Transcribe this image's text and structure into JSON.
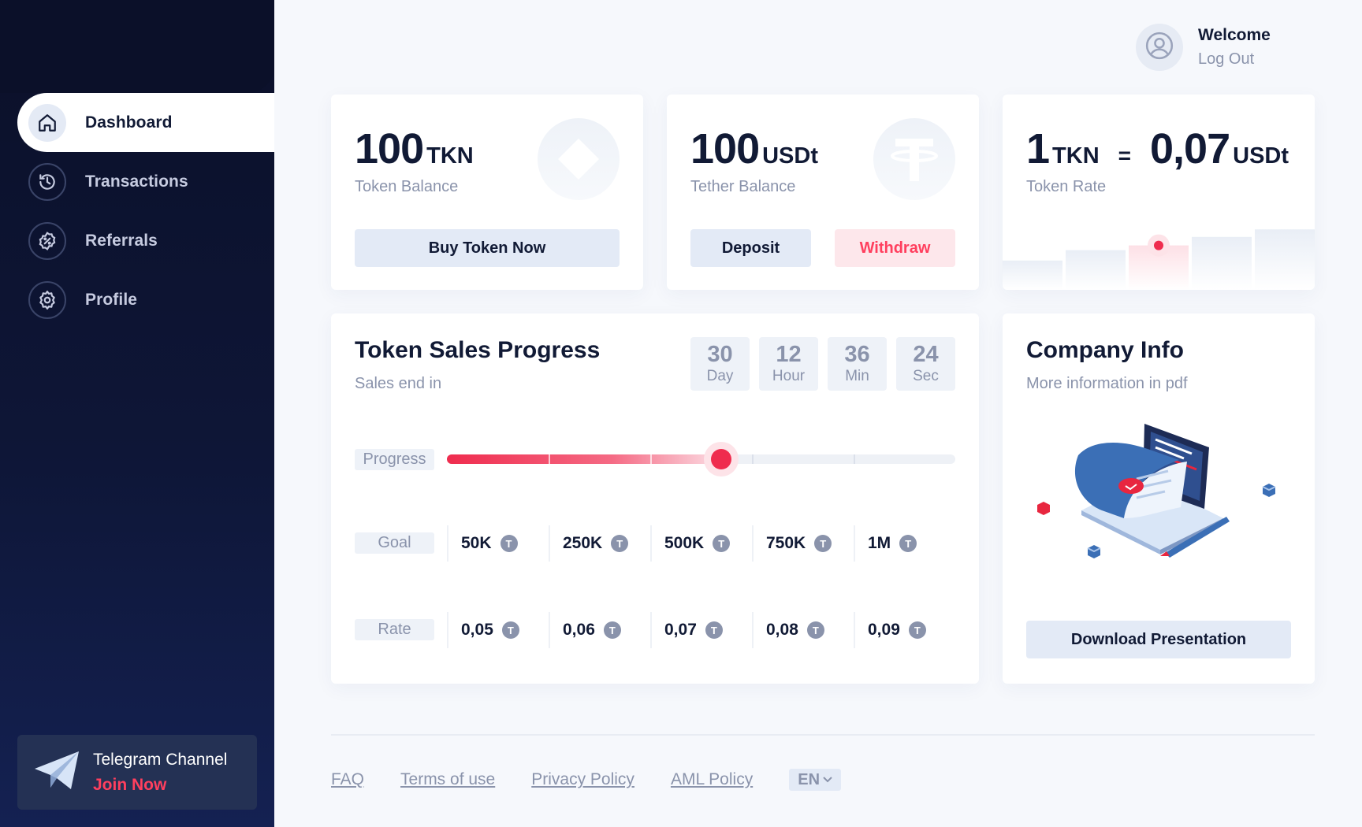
{
  "sidebar": {
    "items": [
      {
        "label": "Dashboard",
        "icon": "home-icon",
        "active": true
      },
      {
        "label": "Transactions",
        "icon": "history-icon"
      },
      {
        "label": "Referrals",
        "icon": "percent-badge-icon"
      },
      {
        "label": "Profile",
        "icon": "gear-icon"
      }
    ],
    "telegram": {
      "title": "Telegram Channel",
      "link": "Join Now",
      "icon": "paper-plane-icon"
    }
  },
  "header": {
    "welcome": "Welcome",
    "logout": "Log Out",
    "avatar_icon": "user-circle-icon"
  },
  "token_card": {
    "amount": "100",
    "unit": "TKN",
    "label": "Token Balance",
    "button": "Buy Token Now",
    "icon": "diamond-icon"
  },
  "tether_card": {
    "amount": "100",
    "unit": "USDt",
    "label": "Tether Balance",
    "deposit": "Deposit",
    "withdraw": "Withdraw",
    "icon": "tether-icon"
  },
  "rate_card": {
    "left_amount": "1",
    "left_unit": "TKN",
    "equals": "=",
    "right_amount": "0,07",
    "right_unit": "USDt",
    "label": "Token Rate",
    "bars": [
      0.31,
      0.42,
      0.47,
      0.56,
      0.64
    ]
  },
  "sales": {
    "title": "Token Sales Progress",
    "subtitle": "Sales end in",
    "countdown": [
      {
        "value": "30",
        "unit": "Day"
      },
      {
        "value": "12",
        "unit": "Hour"
      },
      {
        "value": "36",
        "unit": "Min"
      },
      {
        "value": "24",
        "unit": "Sec"
      }
    ],
    "progress_label": "Progress",
    "progress": 0.54,
    "goal_label": "Goal",
    "goals": [
      "50K",
      "250K",
      "500K",
      "750K",
      "1M"
    ],
    "rate_label": "Rate",
    "rates": [
      "0,05",
      "0,06",
      "0,07",
      "0,08",
      "0,09"
    ],
    "badge_letter": "T"
  },
  "company": {
    "title": "Company Info",
    "subtitle": "More information in pdf",
    "button": "Download Presentation"
  },
  "footer": {
    "links": [
      "FAQ",
      "Terms of use",
      "Privacy Policy",
      "AML Policy"
    ],
    "language": "EN"
  },
  "colors": {
    "accent": "#ef2c4e",
    "sidebar_bg": "#0b1029",
    "text": "#111a35",
    "muted": "#8a93ab",
    "button_bg": "#e3eaf6"
  }
}
